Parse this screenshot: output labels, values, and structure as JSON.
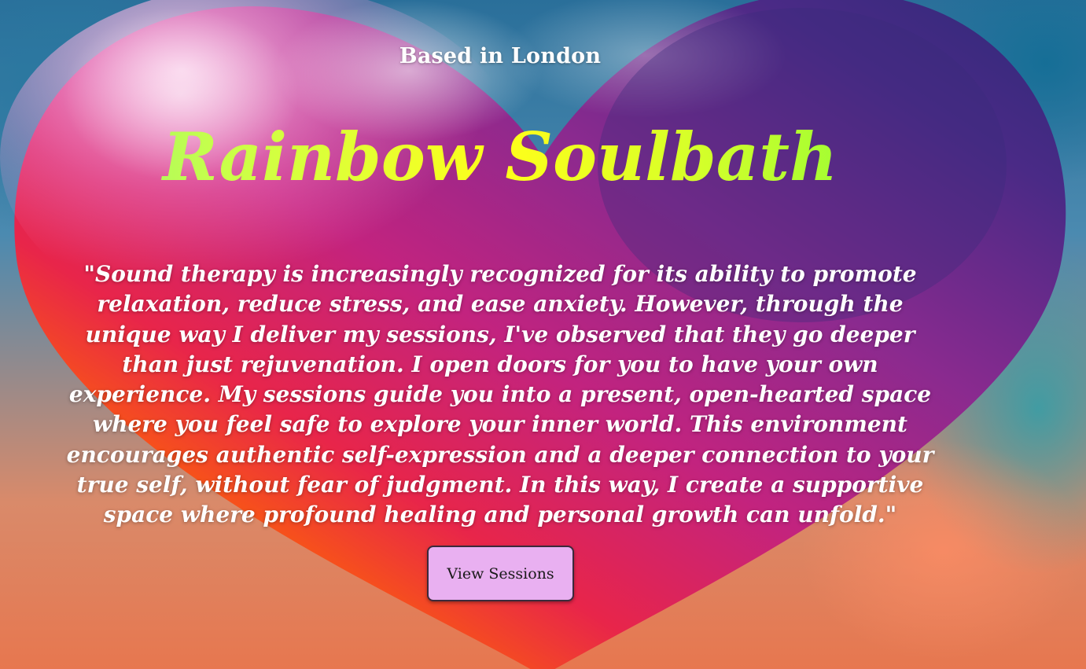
{
  "hero": {
    "location_tag": "Based in London",
    "title": "Rainbow Soulbath",
    "quote": "\"Sound therapy is increasingly recognized for its ability to promote relaxation, reduce stress, and ease anxiety. However, through the unique way I deliver my sessions, I've observed that they go deeper than just rejuvenation. I open doors for you to have your own experience. My sessions guide you into a present, open-hearted space where you feel safe to explore your inner world. This environment encourages authentic self-expression and a deeper connection to your true self, without fear of judgment. In this way, I create a supportive space where profound healing and personal growth can unfold.\"",
    "cta_label": "View Sessions"
  },
  "colors": {
    "title_gradient": [
      "#86f27b",
      "#ffff1a",
      "#6dfb3c"
    ],
    "cta_background": "#e9b0f1",
    "text": "#ffffff"
  }
}
